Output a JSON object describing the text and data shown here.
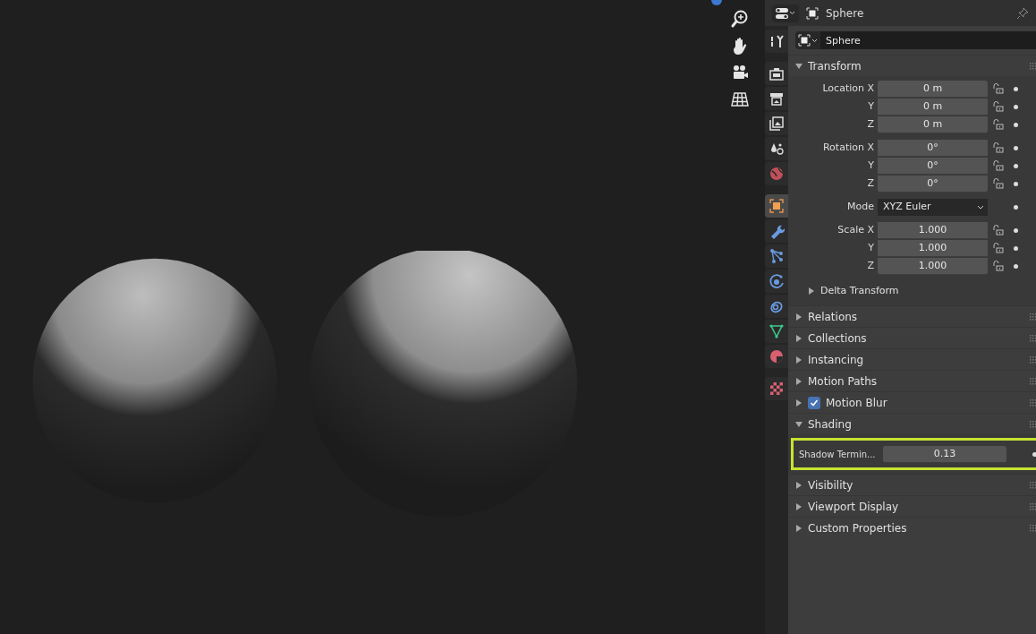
{
  "properties": {
    "header": {
      "title": "Sphere"
    },
    "tabs": [
      {
        "kind": "tool",
        "selected": false
      },
      {
        "kind": "render",
        "selected": false
      },
      {
        "kind": "output",
        "selected": false
      },
      {
        "kind": "view_layer",
        "selected": false
      },
      {
        "kind": "scene",
        "selected": false
      },
      {
        "kind": "world",
        "selected": false
      },
      {
        "kind": "object",
        "selected": true
      },
      {
        "kind": "modifier",
        "selected": false
      },
      {
        "kind": "particles",
        "selected": false
      },
      {
        "kind": "physics",
        "selected": false
      },
      {
        "kind": "constraints",
        "selected": false
      },
      {
        "kind": "data",
        "selected": false
      },
      {
        "kind": "material",
        "selected": false
      },
      {
        "kind": "texture",
        "selected": false
      }
    ],
    "object_name": "Sphere",
    "panels": [
      {
        "title": "Transform",
        "expanded": true,
        "groups": [
          [
            {
              "kind": "number",
              "label": "Location X",
              "value": "0 m"
            },
            {
              "kind": "number",
              "label": "Y",
              "value": "0 m"
            },
            {
              "kind": "number",
              "label": "Z",
              "value": "0 m"
            }
          ],
          [
            {
              "kind": "number",
              "label": "Rotation X",
              "value": "0°"
            },
            {
              "kind": "number",
              "label": "Y",
              "value": "0°"
            },
            {
              "kind": "number",
              "label": "Z",
              "value": "0°"
            }
          ],
          [
            {
              "kind": "dropdown",
              "label": "Mode",
              "value": "XYZ Euler"
            }
          ],
          [
            {
              "kind": "number",
              "label": "Scale X",
              "value": "1.000"
            },
            {
              "kind": "number",
              "label": "Y",
              "value": "1.000"
            },
            {
              "kind": "number",
              "label": "Z",
              "value": "1.000"
            }
          ]
        ],
        "subpanels": [
          {
            "title": "Delta Transform",
            "expanded": false
          }
        ]
      },
      {
        "title": "Relations",
        "expanded": false
      },
      {
        "title": "Collections",
        "expanded": false
      },
      {
        "title": "Instancing",
        "expanded": false
      },
      {
        "title": "Motion Paths",
        "expanded": false
      },
      {
        "title": "Motion Blur",
        "expanded": false,
        "checkbox": {
          "checked": true
        }
      },
      {
        "title": "Shading",
        "expanded": true,
        "groups": [
          [
            {
              "kind": "plain",
              "label": "Shadow Termin...",
              "value": "0.13",
              "highlighted": true
            }
          ]
        ]
      },
      {
        "title": "Visibility",
        "expanded": false
      },
      {
        "title": "Viewport Display",
        "expanded": false
      },
      {
        "title": "Custom Properties",
        "expanded": false
      }
    ]
  }
}
